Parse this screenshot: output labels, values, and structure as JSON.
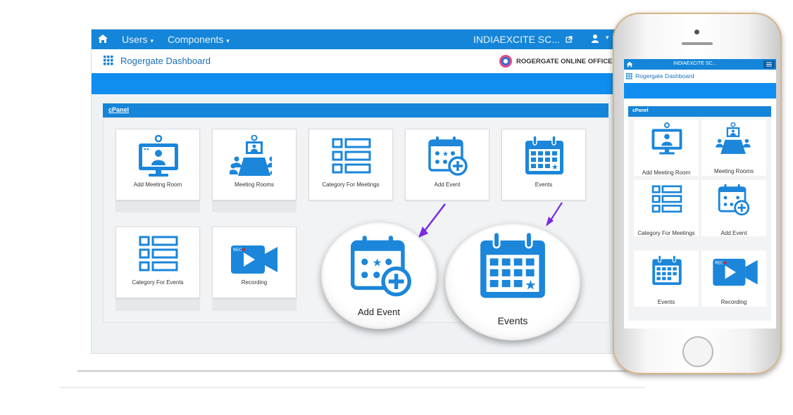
{
  "desktop": {
    "nav": {
      "users_label": "Users",
      "components_label": "Components",
      "site_label": "INDIAEXCITE SC..."
    },
    "header": {
      "title": "Rogergate Dashboard",
      "brand": "ROGERGATE ONLINE OFFICE"
    },
    "cpanel_label": "cPanel",
    "tiles": [
      {
        "label": "Add Meeting Room",
        "icon": "add-meeting-room-icon"
      },
      {
        "label": "Meeting Rooms",
        "icon": "meeting-rooms-icon"
      },
      {
        "label": "Category  For Meetings",
        "icon": "category-list-icon"
      },
      {
        "label": "Add Event",
        "icon": "add-event-icon"
      },
      {
        "label": "Events",
        "icon": "events-calendar-icon"
      },
      {
        "label": "Category  For Events",
        "icon": "category-list-icon"
      },
      {
        "label": "Recording",
        "icon": "recording-camera-icon"
      }
    ]
  },
  "zoom": {
    "add_event_label": "Add Event",
    "events_label": "Events"
  },
  "phone": {
    "site_label": "INDIAEXCITE SC...",
    "header_title": "Rogergate Dashboard",
    "cpanel_label": "cPanel",
    "tiles": [
      {
        "label": "Add Meeting Room"
      },
      {
        "label": "Meeting Rooms"
      },
      {
        "label": "Category  For Meetings"
      },
      {
        "label": "Add Event"
      },
      {
        "label": "Events"
      },
      {
        "label": "Recording"
      }
    ],
    "rec_badge": "REC"
  },
  "colors": {
    "primary": "#1485d8",
    "icon_blue": "#1b86da",
    "band_blue": "#0f8ef0",
    "arrow_purple": "#7a2be2"
  }
}
